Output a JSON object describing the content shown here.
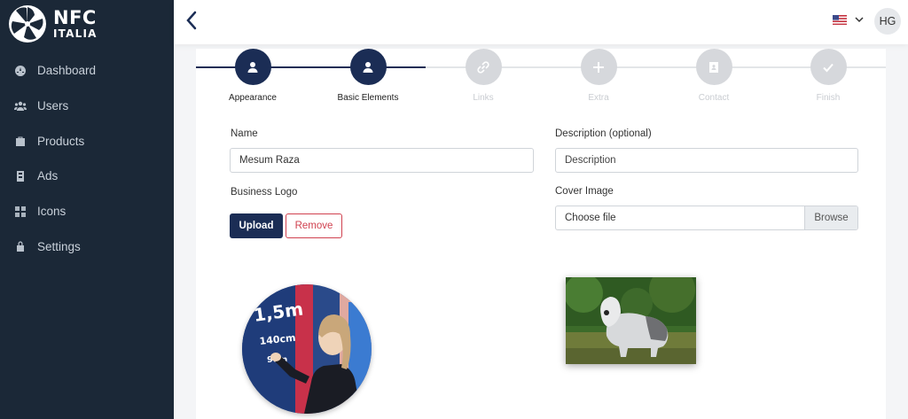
{
  "brand": {
    "line1": "NFC",
    "line2": "ITALIA"
  },
  "sidebar": {
    "items": [
      {
        "label": "Dashboard",
        "icon": "dashboard-icon"
      },
      {
        "label": "Users",
        "icon": "users-icon"
      },
      {
        "label": "Products",
        "icon": "products-icon"
      },
      {
        "label": "Ads",
        "icon": "ads-icon"
      },
      {
        "label": "Icons",
        "icon": "icons-icon"
      },
      {
        "label": "Settings",
        "icon": "settings-icon"
      }
    ]
  },
  "topbar": {
    "avatar_initials": "HG",
    "language_flag": "us-flag-icon"
  },
  "steps": [
    {
      "label": "Appearance",
      "state": "done",
      "icon": "user-icon"
    },
    {
      "label": "Basic Elements",
      "state": "current",
      "icon": "user-icon"
    },
    {
      "label": "Links",
      "state": "upcoming",
      "icon": "link-icon"
    },
    {
      "label": "Extra",
      "state": "upcoming",
      "icon": "plus-icon"
    },
    {
      "label": "Contact",
      "state": "upcoming",
      "icon": "contact-card-icon"
    },
    {
      "label": "Finish",
      "state": "upcoming",
      "icon": "check-icon"
    }
  ],
  "form": {
    "name_label": "Name",
    "name_value": "Mesum Raza",
    "description_label": "Description (optional)",
    "description_placeholder": "Description",
    "business_logo_label": "Business Logo",
    "upload_label": "Upload",
    "remove_label": "Remove",
    "cover_image_label": "Cover Image",
    "cover_file_text": "Choose file",
    "browse_label": "Browse"
  },
  "colors": {
    "sidebar_bg": "#1b2837",
    "accent": "#1b2d55",
    "danger": "#d0414f"
  }
}
